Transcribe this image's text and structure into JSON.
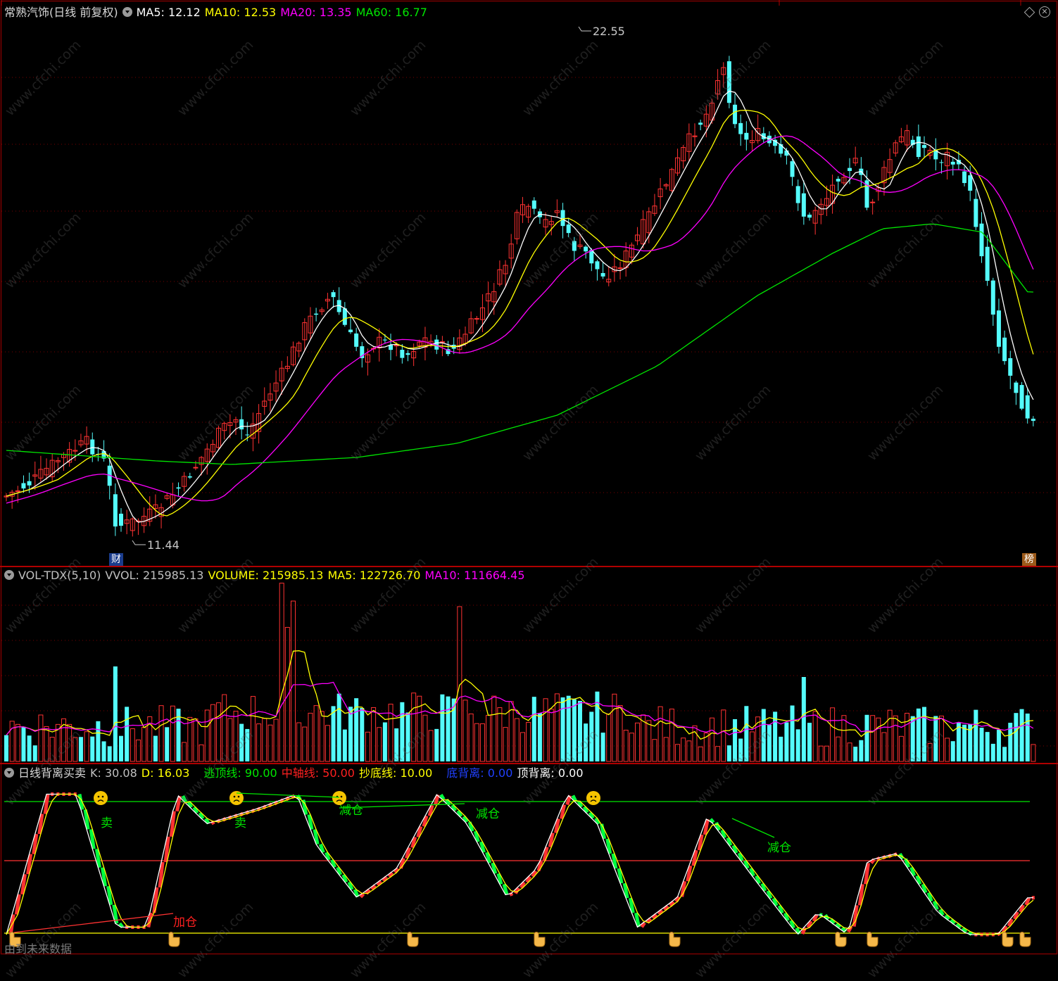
{
  "colors": {
    "up": "#ff3232",
    "down": "#54fcfc",
    "ma5": "#ffffff",
    "ma10": "#ffff00",
    "ma20": "#ff00ff",
    "ma60": "#00e600",
    "grid": "#7a0000"
  },
  "main_panel": {
    "title": "常熟汽饰(日线 前复权)",
    "indicators": [
      {
        "label": "MA5: 12.12",
        "color": "#ffffff"
      },
      {
        "label": "MA10: 12.53",
        "color": "#ffff00"
      },
      {
        "label": "MA20: 13.35",
        "color": "#ff00ff"
      },
      {
        "label": "MA60: 16.77",
        "color": "#00e600"
      }
    ],
    "high_label": "22.55",
    "low_label": "11.44",
    "badge_left": "财",
    "badge_right": "榜"
  },
  "vol_panel": {
    "title": "VOL-TDX(5,10)",
    "indicators": [
      {
        "label": "VVOL: 215985.13",
        "color": "#c0c0c0"
      },
      {
        "label": "VOLUME: 215985.13",
        "color": "#ffff00"
      },
      {
        "label": "MA5: 122726.70",
        "color": "#ffff00"
      },
      {
        "label": "MA10: 111664.45",
        "color": "#ff00ff"
      }
    ]
  },
  "osc_panel": {
    "title": "日线背离买卖",
    "indicators": [
      {
        "label": "K: 30.08",
        "color": "#c0c0c0"
      },
      {
        "label": "D: 16.03",
        "color": "#ffff00"
      },
      {
        "label": "逃顶线: 90.00",
        "color": "#00e600"
      },
      {
        "label": "中轴线: 50.00",
        "color": "#ff2020"
      },
      {
        "label": "抄底线: 10.00",
        "color": "#ffff00"
      },
      {
        "label": "底背离: 0.00",
        "color": "#2040ff"
      },
      {
        "label": "顶背离: 0.00",
        "color": "#ffffff"
      }
    ],
    "signals": [
      {
        "text": "卖",
        "color": "#00e600"
      },
      {
        "text": "卖",
        "color": "#00e600"
      },
      {
        "text": "减仓",
        "color": "#00e600"
      },
      {
        "text": "减仓",
        "color": "#00e600"
      },
      {
        "text": "减仓",
        "color": "#00e600"
      },
      {
        "text": "加仓",
        "color": "#ff2020"
      }
    ]
  },
  "footer": "由到未来数据",
  "watermark": "www.cfchi.com"
}
